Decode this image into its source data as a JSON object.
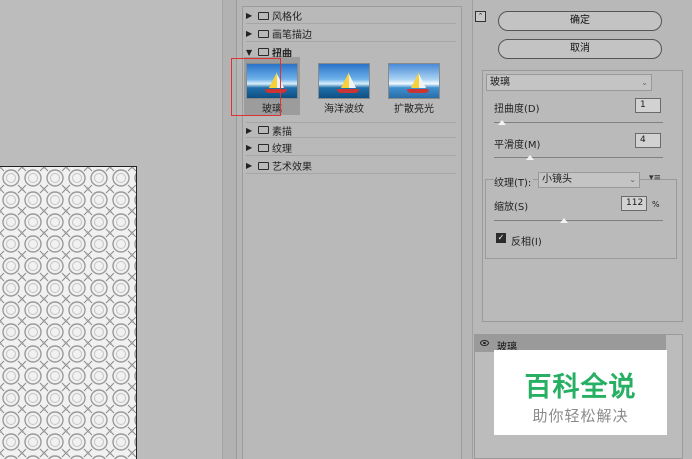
{
  "filter_tree": {
    "folders": [
      {
        "label": "风格化",
        "open": false
      },
      {
        "label": "画笔描边",
        "open": false
      },
      {
        "label": "扭曲",
        "open": true
      },
      {
        "label": "素描",
        "open": false
      },
      {
        "label": "纹理",
        "open": false
      },
      {
        "label": "艺术效果",
        "open": false
      }
    ],
    "thumbnails": [
      {
        "label": "玻璃",
        "selected": true
      },
      {
        "label": "海洋波纹",
        "selected": false
      },
      {
        "label": "扩散亮光",
        "selected": false
      }
    ]
  },
  "buttons": {
    "ok_label": "确定",
    "cancel_label": "取消",
    "collapse_glyph": "⌃"
  },
  "settings": {
    "filter_name": "玻璃",
    "distortion_label": "扭曲度(D)",
    "distortion_value": "1",
    "distortion_level": 0.06,
    "smoothness_label": "平滑度(M)",
    "smoothness_value": "4",
    "smoothness_level": 0.2,
    "texture_label": "纹理(T):",
    "texture_value": "小镜头",
    "scaling_label": "缩放(S)",
    "scaling_value": "112",
    "scaling_unit": "%",
    "scaling_level": 0.5,
    "invert_label": "反相(I)",
    "invert_checked": true
  },
  "layers": {
    "items": [
      {
        "name": "玻璃",
        "visible": true
      }
    ]
  },
  "watermark": {
    "title": "百科全说",
    "subtitle": "助你轻松解决"
  },
  "colors": {
    "selection_outline": "#e03232",
    "watermark_green": "#27b063"
  },
  "icons": [
    "folder-icon",
    "expand-arrow-icon",
    "eye-icon",
    "chevron-down-icon",
    "menu-icon",
    "collapse-icon"
  ]
}
